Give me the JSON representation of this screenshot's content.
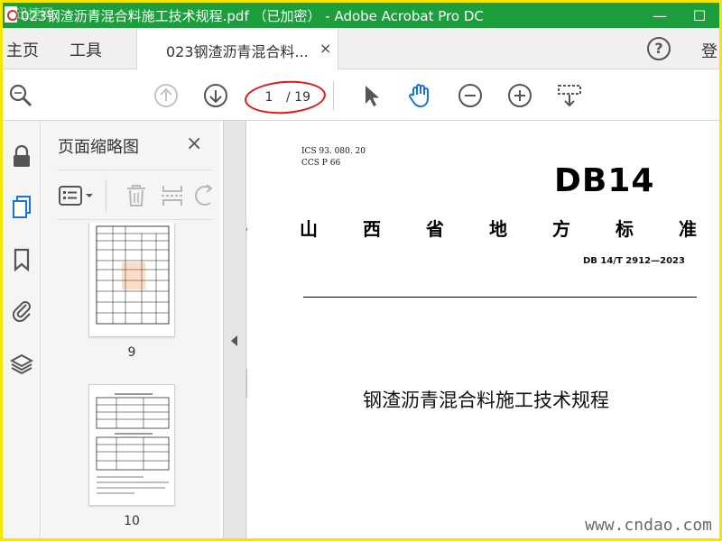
{
  "window": {
    "title": "023钢渣沥青混合料施工技术规程.pdf （已加密） - Adobe Acrobat Pro DC",
    "minimize_glyph": "—",
    "maximize_glyph": "☐",
    "titlebar_color": "#1b9e3b",
    "frame_color": "#f3e600"
  },
  "menu": {
    "home": "主页",
    "tools": "工具",
    "doc_tab": "023钢渣沥青混合料...",
    "close_glyph": "×",
    "help_glyph": "?",
    "signin": "登"
  },
  "toolbar": {
    "current_page": "1",
    "total_pages": "/ 19",
    "icons": [
      "zoom-search-icon",
      "page-up-icon",
      "page-down-icon",
      "select-cursor-icon",
      "hand-tool-icon",
      "zoom-out-icon",
      "zoom-in-icon",
      "marquee-zoom-icon"
    ]
  },
  "rail": {
    "icons": [
      "lock-icon",
      "pages-icon",
      "bookmark-icon",
      "attachment-icon",
      "layers-icon"
    ]
  },
  "thumbnails": {
    "title": "页面缩略图",
    "close_glyph": "×",
    "pages": [
      {
        "label": "9"
      },
      {
        "label": "10"
      }
    ]
  },
  "document": {
    "ics": "ICS  93. 080. 20",
    "ccs": "CCS  P  66",
    "logo": "DB14",
    "province_chars": [
      "山",
      "西",
      "省",
      "地",
      "方",
      "标",
      "准"
    ],
    "std_number": "DB 14/T  2912—2023",
    "title": "钢渣沥青混合料施工技术规程"
  },
  "watermarks": {
    "bottom_right": "www.cndao.com",
    "top_left": "迅捷网"
  },
  "accent_colors": {
    "hand_tool": "#1473e6",
    "annotation_ellipse": "#e01818"
  }
}
